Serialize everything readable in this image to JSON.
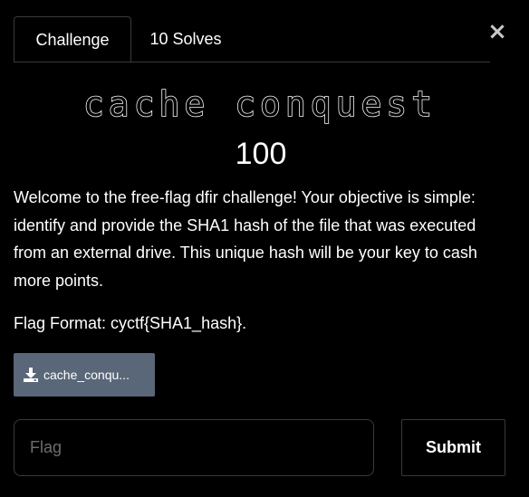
{
  "tabs": [
    {
      "label": "Challenge",
      "active": true
    },
    {
      "label": "10 Solves",
      "active": false
    }
  ],
  "close_label": "×",
  "challenge": {
    "title": "cache conquest",
    "points": "100",
    "description": "Welcome to the free-flag dfir challenge! Your objective is simple: identify and provide the SHA1 hash of the file that was executed from an external drive. This unique hash will be your key to cash more points.",
    "flag_format": "Flag Format: cyctf{SHA1_hash}."
  },
  "file": {
    "label": "cache_conqu...",
    "icon": "download-icon"
  },
  "form": {
    "placeholder": "Flag",
    "value": "",
    "submit_label": "Submit"
  },
  "colors": {
    "background": "#000000",
    "file_button": "#5a6778",
    "border": "#3a3a3a"
  }
}
